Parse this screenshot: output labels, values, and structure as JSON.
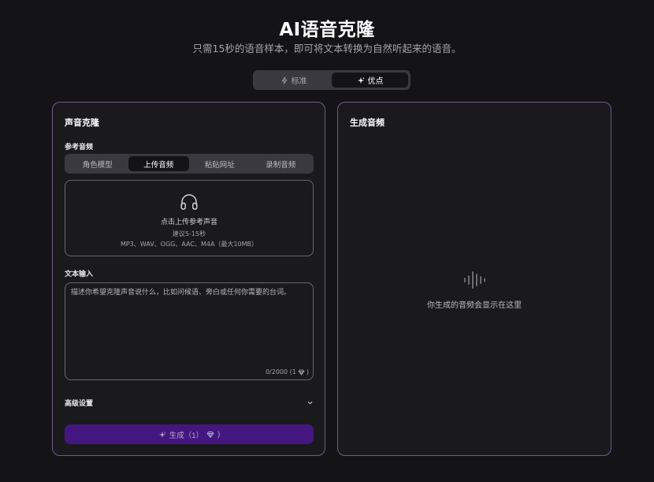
{
  "header": {
    "title": "AI语音克隆",
    "subtitle": "只需15秒的语音样本，即可将文本转换为自然听起来的语音。"
  },
  "mode_toggle": {
    "options": [
      {
        "label": "标准",
        "icon": "lightning-icon",
        "active": false
      },
      {
        "label": "优点",
        "icon": "sparkle-icon",
        "active": true
      }
    ]
  },
  "left_panel": {
    "title": "声音克隆",
    "reference_label": "参考音频",
    "reference_tabs": [
      {
        "label": "角色模型",
        "active": false
      },
      {
        "label": "上传音频",
        "active": true
      },
      {
        "label": "粘贴网址",
        "active": false
      },
      {
        "label": "录制音频",
        "active": false
      }
    ],
    "upload": {
      "icon": "headphones-icon",
      "main_text": "点击上传参考声音",
      "hint": "建议5-15秒",
      "formats": "MP3、WAV、OGG、AAC、M4A（最大10MB）"
    },
    "text_input": {
      "label": "文本输入",
      "value": "",
      "placeholder": "描述你希望克隆声音说什么，比如问候语、旁白或任何你需要的台词。",
      "char_count": "0/2000 (1",
      "char_count_suffix": ")",
      "cost_icon": "gem-icon"
    },
    "advanced": {
      "label": "高级设置",
      "icon": "chevron-down-icon"
    },
    "generate_button": {
      "label": "生成（1）",
      "suffix": ")",
      "icon": "sparkle-icon",
      "cost_icon": "gem-icon"
    }
  },
  "right_panel": {
    "title": "生成音频",
    "empty_icon": "waveform-icon",
    "empty_text": "你生成的音频会显示在这里"
  },
  "colors": {
    "background": "#141316",
    "panel_border": "#6f5b8c",
    "accent": "#441680",
    "toggle_bg": "#3a3940"
  }
}
